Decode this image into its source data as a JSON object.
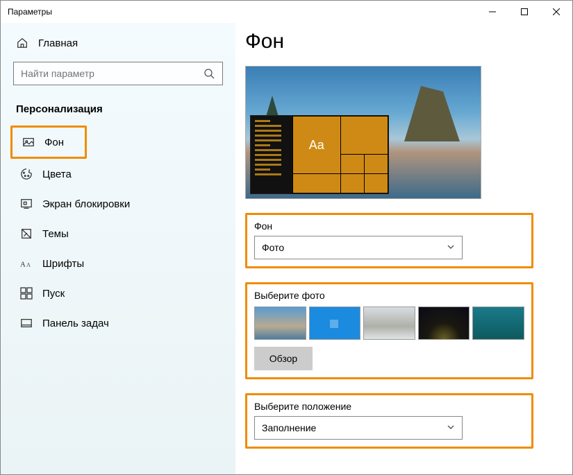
{
  "window": {
    "title": "Параметры"
  },
  "sidebar": {
    "home": "Главная",
    "search_placeholder": "Найти параметр",
    "category": "Персонализация",
    "items": [
      {
        "label": "Фон"
      },
      {
        "label": "Цвета"
      },
      {
        "label": "Экран блокировки"
      },
      {
        "label": "Темы"
      },
      {
        "label": "Шрифты"
      },
      {
        "label": "Пуск"
      },
      {
        "label": "Панель задач"
      }
    ]
  },
  "content": {
    "heading": "Фон",
    "preview_aa": "Aa",
    "bg_section_label": "Фон",
    "bg_dropdown_value": "Фото",
    "choose_photo_label": "Выберите фото",
    "browse_label": "Обзор",
    "position_label": "Выберите положение",
    "position_value": "Заполнение"
  }
}
